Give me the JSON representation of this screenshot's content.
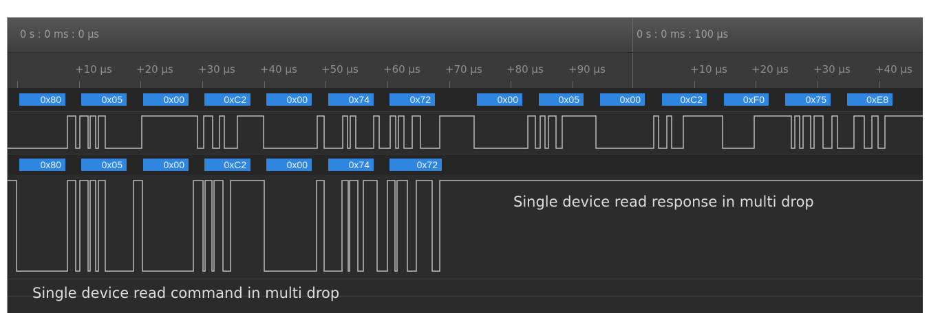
{
  "timeline": {
    "start_label": "0 s : 0 ms : 0 µs",
    "mid_label": "0 s : 0 ms : 100 µs",
    "ticks_first": [
      "+10 µs",
      "+20 µs",
      "+30 µs",
      "+40 µs",
      "+50 µs",
      "+60 µs",
      "+70 µs",
      "+80 µs",
      "+90 µs"
    ],
    "ticks_second": [
      "+10 µs",
      "+20 µs",
      "+30 µs",
      "+40 µs"
    ]
  },
  "channel_response": {
    "bytes": [
      "0x80",
      "0x05",
      "0x00",
      "0xC2",
      "0x00",
      "0x74",
      "0x72",
      "0x00",
      "0x05",
      "0x00",
      "0xC2",
      "0xF0",
      "0x75",
      "0xE8"
    ]
  },
  "channel_command": {
    "bytes": [
      "0x80",
      "0x05",
      "0x00",
      "0xC2",
      "0x00",
      "0x74",
      "0x72"
    ]
  },
  "captions": {
    "response": "Single device read response in multi drop",
    "command": "Single device read command in multi drop"
  },
  "colors": {
    "background": "#2b2b2b",
    "byte_chip": "#2e86e0",
    "waveform": "#bdbdbd",
    "text": "#dcdcdc"
  }
}
